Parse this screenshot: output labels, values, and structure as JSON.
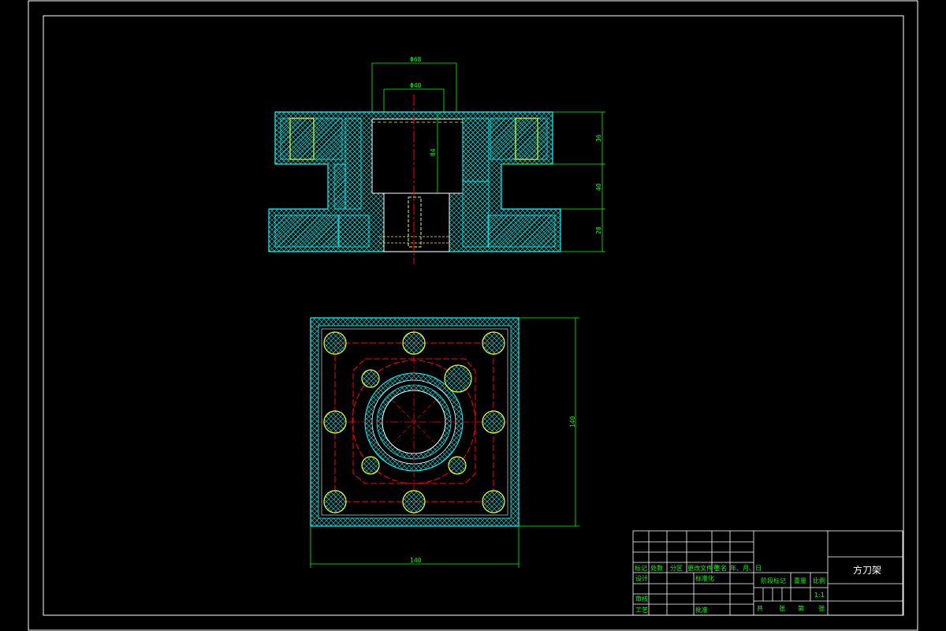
{
  "dimensions": {
    "top_outer_dia": "Φ68",
    "top_inner_dia": "Φ40",
    "bore_depth": "84",
    "height_1": "36",
    "height_2": "40",
    "height_3": "28",
    "plan_height": "140",
    "plan_width": "140"
  },
  "title_block": {
    "mark": "标记",
    "count": "处数",
    "zone": "分区",
    "change_doc": "更改文件号",
    "signature": "签名",
    "date": "年、月、日",
    "design": "设计",
    "standardization": "标准化",
    "review": "审核",
    "process": "工艺",
    "approve": "批准",
    "stage_mark": "阶段标记",
    "weight": "重量",
    "scale_label": "比例",
    "scale_value": "1:1",
    "total": "共",
    "sheets": "张",
    "page": "第",
    "sheet": "张",
    "drawing_name": "方刀架"
  },
  "colors": {
    "frame": "#ffffff",
    "hatch": "#00ffff",
    "hatch_alt": "#00aaaa",
    "centerline": "#ff0000",
    "dimension": "#00ff00",
    "holes": "#ffff00"
  }
}
